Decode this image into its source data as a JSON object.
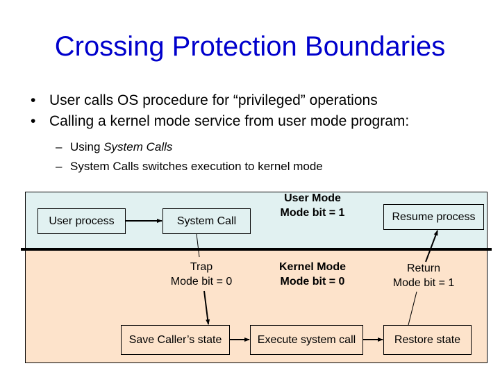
{
  "slide": {
    "title": "Crossing Protection Boundaries",
    "bullets": [
      {
        "marker": "•",
        "text": "User calls OS procedure for “privileged” operations"
      },
      {
        "marker": "•",
        "text": "Calling a kernel mode service from user mode program:"
      }
    ],
    "sub_bullets": [
      {
        "marker": "–",
        "prefix": "Using ",
        "emphasis": "System Calls",
        "suffix": ""
      },
      {
        "marker": "–",
        "prefix": "System Calls switches execution to kernel mode",
        "emphasis": "",
        "suffix": ""
      }
    ]
  },
  "diagram": {
    "colors": {
      "title": "#0000CC",
      "user_region": "#E1F1F1",
      "kernel_region": "#FDE3CB",
      "lines": "#000000"
    },
    "user_region": {
      "mode_label_line1": "User Mode",
      "mode_label_line2": "Mode bit = 1"
    },
    "kernel_region": {
      "mode_label_line1": "Kernel Mode",
      "mode_label_line2": "Mode bit = 0"
    },
    "nodes": {
      "user_process": "User process",
      "system_call": "System Call",
      "resume_process": "Resume process",
      "save_state": "Save Caller’s state",
      "execute_call": "Execute system call",
      "restore_state": "Restore state"
    },
    "transitions": {
      "trap_line1": "Trap",
      "trap_line2": "Mode bit = 0",
      "return_line1": "Return",
      "return_line2": "Mode bit = 1"
    }
  }
}
